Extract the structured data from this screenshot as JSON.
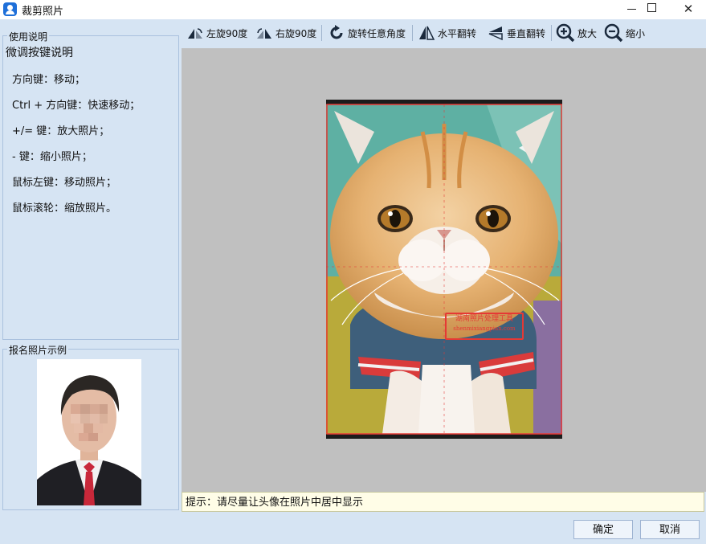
{
  "window": {
    "title": "裁剪照片"
  },
  "usage": {
    "legend": "使用说明",
    "heading": "微调按键说明",
    "lines": [
      "方向键：移动；",
      "Ctrl + 方向键：快速移动；",
      "+/= 键：放大照片；",
      "- 键：缩小照片；",
      "鼠标左键：移动照片；",
      "鼠标滚轮：缩放照片。"
    ]
  },
  "sample": {
    "legend": "报名照片示例"
  },
  "toolbar": {
    "rotate_left": "左旋90度",
    "rotate_right": "右旋90度",
    "rotate_any": "旋转任意角度",
    "flip_h": "水平翻转",
    "flip_v": "垂直翻转",
    "zoom_in": "放大",
    "zoom_out": "缩小"
  },
  "photo": {
    "watermark": "湖南照片处理工具",
    "watermark_sub": "shenmixiangpian.com"
  },
  "hint": "提示：请尽量让头像在照片中居中显示",
  "buttons": {
    "ok": "确定",
    "cancel": "取消"
  },
  "colors": {
    "accent": "#1e6fd9",
    "crop_border": "#e53935",
    "canvas": "#c0c0c0",
    "panel": "#d6e4f3"
  }
}
